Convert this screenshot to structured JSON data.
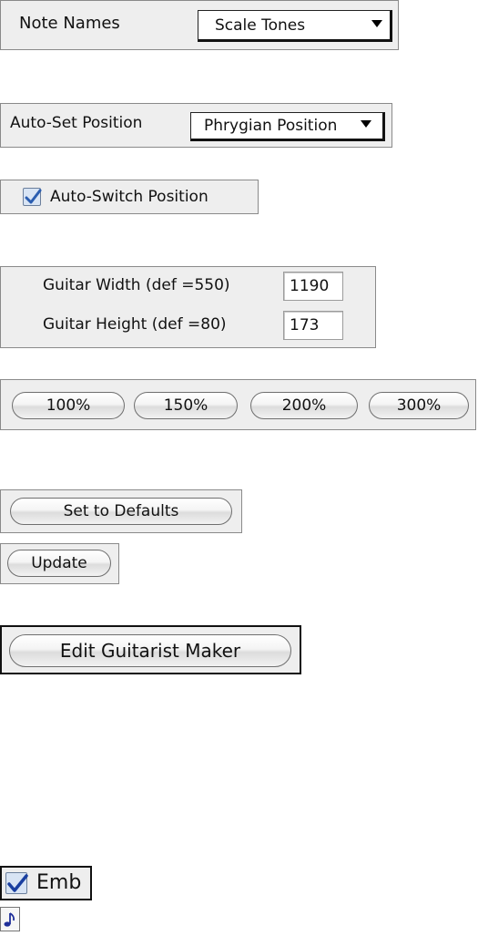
{
  "note_names": {
    "label": "Note Names",
    "value": "Scale Tones"
  },
  "auto_set_position": {
    "label": "Auto-Set Position",
    "value": "Phrygian Position"
  },
  "auto_switch_position": {
    "label": "Auto-Switch Position",
    "checked": true
  },
  "guitar_size": {
    "width_label": "Guitar Width (def =550)",
    "width_value": "1190",
    "height_label": "Guitar Height (def =80)",
    "height_value": "173"
  },
  "zoom_buttons": [
    "100%",
    "150%",
    "200%",
    "300%"
  ],
  "set_defaults_label": "Set to Defaults",
  "update_label": "Update",
  "edit_guitarist_label": "Edit Guitarist Maker",
  "emb": {
    "label": "Emb",
    "checked": true
  },
  "colors": {
    "checkbox_fill": "#d8e4f4",
    "check_mark": "#2a5db0",
    "note_icon": "#1f2f9a"
  },
  "icons": [
    "chevron-down-icon",
    "checkmark-icon",
    "eighth-note-icon"
  ]
}
